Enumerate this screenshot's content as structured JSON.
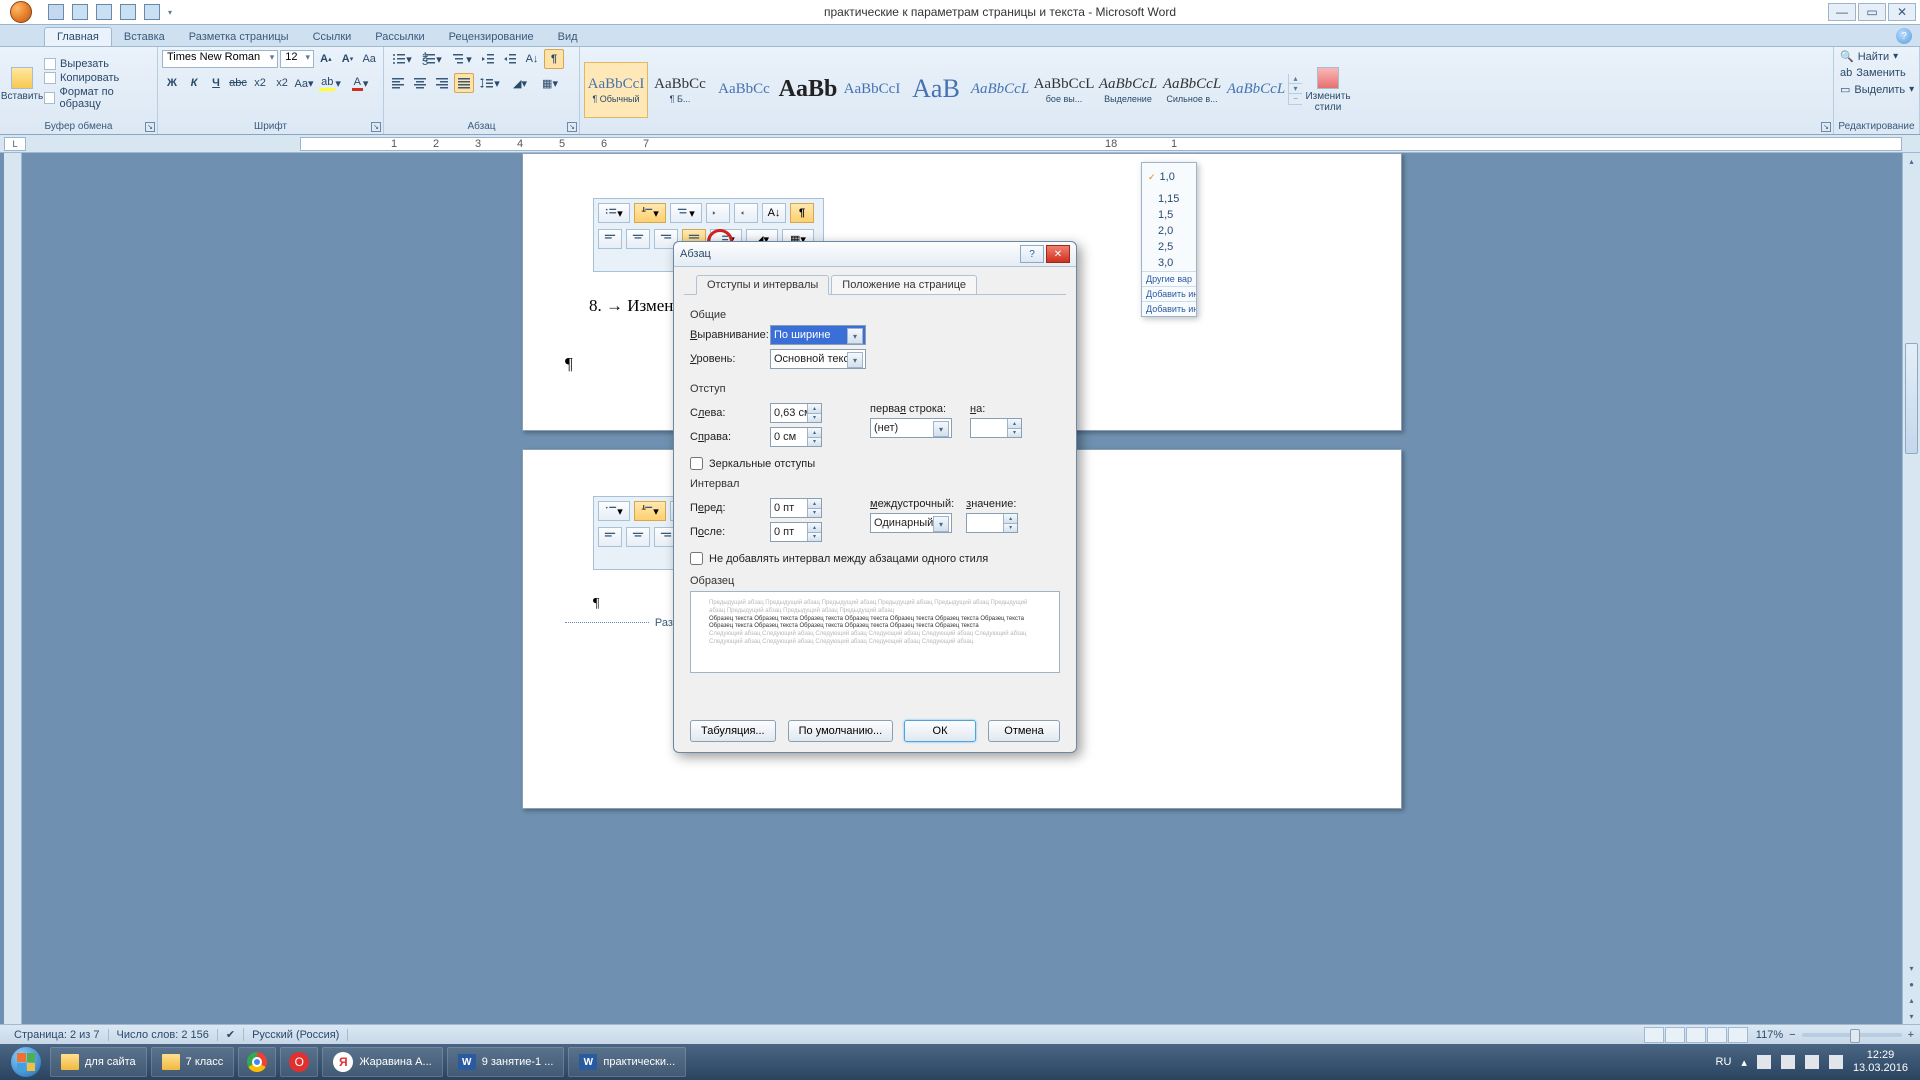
{
  "titlebar": {
    "title": "практические к параметрам страницы и текста - Microsoft Word"
  },
  "tabs": {
    "home": "Главная",
    "insert": "Вставка",
    "pagelayout": "Разметка страницы",
    "refs": "Ссылки",
    "mail": "Рассылки",
    "review": "Рецензирование",
    "view": "Вид"
  },
  "clipboard": {
    "group": "Буфер обмена",
    "paste": "Вставить",
    "cut": "Вырезать",
    "copy": "Копировать",
    "format": "Формат по образцу"
  },
  "font": {
    "group": "Шрифт",
    "name": "Times New Roman",
    "size": "12"
  },
  "para": {
    "group": "Абзац"
  },
  "styles": {
    "items": [
      {
        "prev": "AaBbCcI",
        "label": "¶ Обычный",
        "cls": "col",
        "sel": true
      },
      {
        "prev": "AaBbCc",
        "label": "¶ Б...",
        "cls": ""
      },
      {
        "prev": "AaBbCc",
        "label": "",
        "cls": "col"
      },
      {
        "prev": "AaBb",
        "label": "",
        "cls": "big"
      },
      {
        "prev": "AaBbCcI",
        "label": "",
        "cls": "col"
      },
      {
        "prev": "AaB",
        "label": "",
        "cls": "big2"
      },
      {
        "prev": "AaBbCcL",
        "label": "",
        "cls": "col"
      },
      {
        "prev": "AaBbCcL",
        "label": "бое вы...",
        "cls": ""
      },
      {
        "prev": "AaBbCcL",
        "label": "Выделение",
        "cls": ""
      },
      {
        "prev": "AaBbCcL",
        "label": "Сильное в...",
        "cls": ""
      },
      {
        "prev": "AaBbCcL",
        "label": "",
        "cls": ""
      }
    ],
    "change": "Изменить\nстили"
  },
  "editing": {
    "group": "Редактирование",
    "find": "Найти",
    "replace": "Заменить",
    "select": "Выделить"
  },
  "linemenu": {
    "v1": "1,0",
    "v2": "1,15",
    "v3": "1,5",
    "v4": "2,0",
    "v5": "2,5",
    "v6": "3,0",
    "other": "Другие вар",
    "add1": "Добавить инт",
    "add2": "Добавить инт"
  },
  "document": {
    "snippet_label": "Абзац",
    "line1": "8. → Изменение·параметров·абзаца.·Отрыт",
    "pagebreak": "Разрыв страницы"
  },
  "dialog": {
    "title": "Абзац",
    "tab1": "Отступы и интервалы",
    "tab2": "Положение на странице",
    "s_general": "Общие",
    "align_lbl": "Выравнивание:",
    "align_val": "По ширине",
    "level_lbl": "Уровень:",
    "level_val": "Основной текст",
    "s_indent": "Отступ",
    "left_lbl": "Слева:",
    "left_val": "0,63 см",
    "right_lbl": "Справа:",
    "right_val": "0 см",
    "first_lbl": "первая строка:",
    "first_val": "(нет)",
    "on_lbl": "на:",
    "mirror": "Зеркальные отступы",
    "s_interval": "Интервал",
    "before_lbl": "Перед:",
    "before_val": "0 пт",
    "after_lbl": "После:",
    "after_val": "0 пт",
    "line_lbl": "междустрочный:",
    "line_val": "Одинарный",
    "val_lbl": "значение:",
    "nosame": "Не добавлять интервал между абзацами одного стиля",
    "s_sample": "Образец",
    "sample_grey": "Предыдущий абзац Предыдущий абзац Предыдущий абзац Предыдущий абзац Предыдущий абзац Предыдущий абзац Предыдущий абзац Предыдущий абзац Предыдущий абзац",
    "sample_dark": "Образец текста Образец текста Образец текста Образец текста Образец текста Образец текста Образец текста Образец текста Образец текста Образец текста Образец текста Образец текста Образец текста",
    "sample_grey2": "Следующий абзац Следующий абзац Следующий абзац Следующий абзац Следующий абзац Следующий абзац Следующий абзац Следующий абзац Следующий абзац Следующий абзац Следующий абзац",
    "btn_tab": "Табуляция...",
    "btn_def": "По умолчанию...",
    "btn_ok": "ОК",
    "btn_cancel": "Отмена"
  },
  "statusbar": {
    "page": "Страница: 2 из 7",
    "words": "Число слов: 2 156",
    "lang": "Русский (Россия)",
    "zoom": "117%"
  },
  "taskbar": {
    "items": [
      {
        "label": "для сайта",
        "icon": "folder"
      },
      {
        "label": "7 класс",
        "icon": "folder"
      },
      {
        "label": "",
        "icon": "chrome"
      },
      {
        "label": "",
        "icon": "opera"
      },
      {
        "label": "Жаравина А...",
        "icon": "yandex",
        "ytext": "Я"
      },
      {
        "label": "9 занятие-1 ...",
        "icon": "word",
        "wtext": "W"
      },
      {
        "label": "практически...",
        "icon": "word",
        "wtext": "W"
      }
    ],
    "lang": "RU",
    "time": "12:29",
    "date": "13.03.2016"
  }
}
